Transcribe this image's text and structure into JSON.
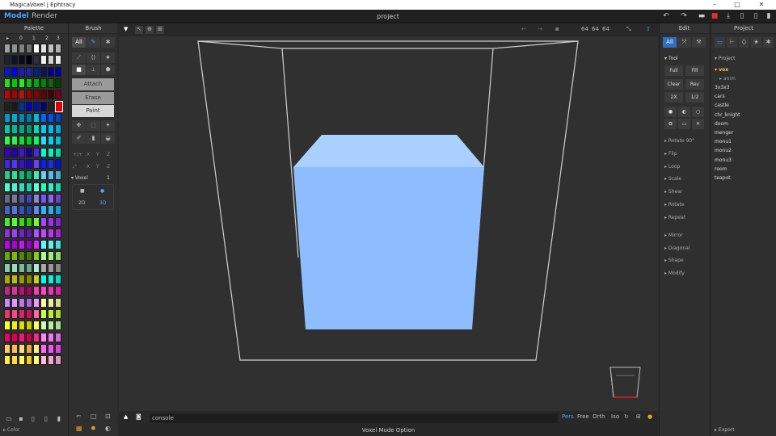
{
  "window": {
    "title": "MagicaVoxel | Ephtracy",
    "minimize": "–",
    "maximize": "□",
    "close": "✕"
  },
  "menubar": {
    "model": "Model",
    "render": "Render",
    "project_name": "project"
  },
  "palette": {
    "title": "Palette",
    "tabs": [
      "▸",
      "0",
      "1",
      "2",
      "3"
    ],
    "footer_label": "Color",
    "selected_color": "#dd0000",
    "colors": [
      [
        "#a0a0a0",
        "#909090",
        "#808080",
        "#707070",
        "#ffffff",
        "#e0e0e0",
        "#c0c0c0",
        "#b0b0b0",
        "#606060"
      ],
      [
        "#202030",
        "#10102a",
        "#0a0a20",
        "#000010",
        "#303040",
        "#f0f0f0",
        "#d0d0d0",
        "#e8e8e8",
        "#505050"
      ],
      [
        "#001ad0",
        "#0000f0",
        "#1b1bc0",
        "#2222aa",
        "#00208a",
        "#101060",
        "#000088",
        "#0000aa",
        "#0030ff"
      ],
      [
        "#22dd22",
        "#00cc00",
        "#22ee22",
        "#11bb11",
        "#00aa00",
        "#008800",
        "#116611",
        "#004400",
        "#33ff33"
      ],
      [
        "#cc0000",
        "#aa0000",
        "#bb1111",
        "#990000",
        "#880000",
        "#660000",
        "#440000",
        "#770011",
        "#ee1111"
      ],
      [
        "#202020",
        "#1a1a1a",
        "#003399",
        "#0000cc",
        "#0011aa",
        "#000077",
        "#222222",
        "#dd0000",
        "#dd0000"
      ],
      [
        "#0099cc",
        "#00aacc",
        "#0088bb",
        "#0077aa",
        "#00bbdd",
        "#0066ff",
        "#0055ee",
        "#0044cc",
        "#0077dd"
      ],
      [
        "#00ccaa",
        "#00bb99",
        "#00aa88",
        "#009977",
        "#00ddbb",
        "#00ccff",
        "#00bbee",
        "#00aadd",
        "#0099cc"
      ],
      [
        "#22ff44",
        "#33ee55",
        "#11dd33",
        "#00cc22",
        "#00ff66",
        "#22ddff",
        "#11ccee",
        "#00bbdd",
        "#00aacc"
      ],
      [
        "#3300cc",
        "#2200bb",
        "#4411dd",
        "#1100aa",
        "#5522ee",
        "#00ffcc",
        "#11eebb",
        "#00ddaa",
        "#00cc99"
      ],
      [
        "#4422ee",
        "#5533ff",
        "#3311dd",
        "#2200cc",
        "#6644ff",
        "#0022ff",
        "#1133ee",
        "#0011dd",
        "#2244ff"
      ],
      [
        "#22cc88",
        "#33dd99",
        "#11bb77",
        "#00aa66",
        "#44eeaa",
        "#66ccff",
        "#55bbee",
        "#44aadd",
        "#3399cc"
      ],
      [
        "#44ffcc",
        "#55eedd",
        "#33ddbb",
        "#22ccaa",
        "#66ffdd",
        "#22ffbb",
        "#33eecc",
        "#11ddaa",
        "#00cc99"
      ],
      [
        "#666688",
        "#777799",
        "#5555aa",
        "#4444bb",
        "#8888cc",
        "#7755ff",
        "#8866ee",
        "#6644dd",
        "#5533cc"
      ],
      [
        "#4466cc",
        "#5577dd",
        "#3355bb",
        "#2244aa",
        "#6688ee",
        "#22bbff",
        "#33aaee",
        "#1199dd",
        "#0088cc"
      ],
      [
        "#44ee22",
        "#55ff33",
        "#33dd11",
        "#22cc00",
        "#66ff44",
        "#aa44ff",
        "#9933ee",
        "#8822dd",
        "#7711cc"
      ],
      [
        "#8833dd",
        "#9944ee",
        "#7722cc",
        "#6611bb",
        "#aa55ff",
        "#cc44ff",
        "#bb33ee",
        "#aa22dd",
        "#9911cc"
      ],
      [
        "#bb00ee",
        "#aa00dd",
        "#cc11ff",
        "#9900cc",
        "#dd22ff",
        "#55ffff",
        "#66eeee",
        "#44dddd",
        "#33cccc"
      ],
      [
        "#66aa00",
        "#77bb11",
        "#558800",
        "#447700",
        "#88cc22",
        "#aaff88",
        "#99ee77",
        "#88dd66",
        "#77cc55"
      ],
      [
        "#88ccaa",
        "#99ddbb",
        "#77bb99",
        "#66aa88",
        "#aaeecc",
        "#aaaaaa",
        "#999999",
        "#888888",
        "#bbbbbb"
      ],
      [
        "#aaaa00",
        "#bbbb11",
        "#999900",
        "#888800",
        "#cccc22",
        "#00ffee",
        "#11eedd",
        "#00ddcc",
        "#00ccbb"
      ],
      [
        "#cc2288",
        "#dd3399",
        "#bb1177",
        "#aa0066",
        "#ee44aa",
        "#ff44cc",
        "#ee33bb",
        "#dd22aa",
        "#cc1199"
      ],
      [
        "#cc88ff",
        "#dd99ff",
        "#bb77ee",
        "#aa66dd",
        "#ee99ff",
        "#ffffaa",
        "#eeee99",
        "#dddd88",
        "#cccc77"
      ],
      [
        "#ee3377",
        "#ff4488",
        "#dd2266",
        "#cc1155",
        "#ff66aa",
        "#ccff44",
        "#bbee33",
        "#aadd22",
        "#99cc11"
      ],
      [
        "#ffff22",
        "#eeee11",
        "#dddd00",
        "#cccc00",
        "#ffff55",
        "#ccffaa",
        "#bbee99",
        "#aadd88",
        "#99cc77"
      ],
      [
        "#ee0066",
        "#dd0055",
        "#ff1177",
        "#cc0044",
        "#ff2288",
        "#ff88ff",
        "#ee77ee",
        "#dd66dd",
        "#cc55cc"
      ],
      [
        "#ffcc66",
        "#ffbb55",
        "#ffdd77",
        "#eeaa44",
        "#ffee88",
        "#ff66ff",
        "#ee55ee",
        "#dd44dd",
        "#cc33cc"
      ],
      [
        "#ffee44",
        "#ffdd33",
        "#ffff55",
        "#eecc22",
        "#ffff77",
        "#ffbbdd",
        "#eeaacc",
        "#dd99bb",
        "#cc88aa"
      ]
    ]
  },
  "brush": {
    "title": "Brush",
    "tab_all": "All",
    "modes": [
      "Attach",
      "Erase",
      "Paint"
    ],
    "selected_mode": "Paint",
    "axis_labels": [
      "X",
      "Y",
      "Z"
    ],
    "voxel_label": "Voxel",
    "voxel_value": "1",
    "option_2d": "2D",
    "option_3d": "3D"
  },
  "viewport": {
    "size_readout": [
      "64",
      "64",
      "64"
    ],
    "console_text": "console",
    "views": [
      "Pers",
      "Free",
      "Orth",
      "Iso"
    ],
    "active_view": "Pers",
    "status": "Voxel Mode Option",
    "cube_color": "#8dbcff"
  },
  "edit": {
    "title": "Edit",
    "tab_all": "All",
    "tool_label": "Tool",
    "buttons": [
      "Full",
      "Fill",
      "Clear",
      "Rev",
      "2X",
      "1/2"
    ],
    "sections": [
      "Rotate 90°",
      "Flip",
      "Loop",
      "Scale",
      "Shear",
      "Rotate",
      "Repeat",
      "Mirror",
      "Diagonal",
      "Shape",
      "Modify"
    ]
  },
  "project": {
    "title": "Project",
    "list_label": "Project",
    "selected": "vox",
    "sub_item": "anim",
    "items": [
      "3x3x3",
      "cars",
      "castle",
      "chr_knight",
      "doom",
      "menger",
      "monu1",
      "monu2",
      "monu3",
      "room",
      "teapot"
    ],
    "export_label": "Export"
  }
}
